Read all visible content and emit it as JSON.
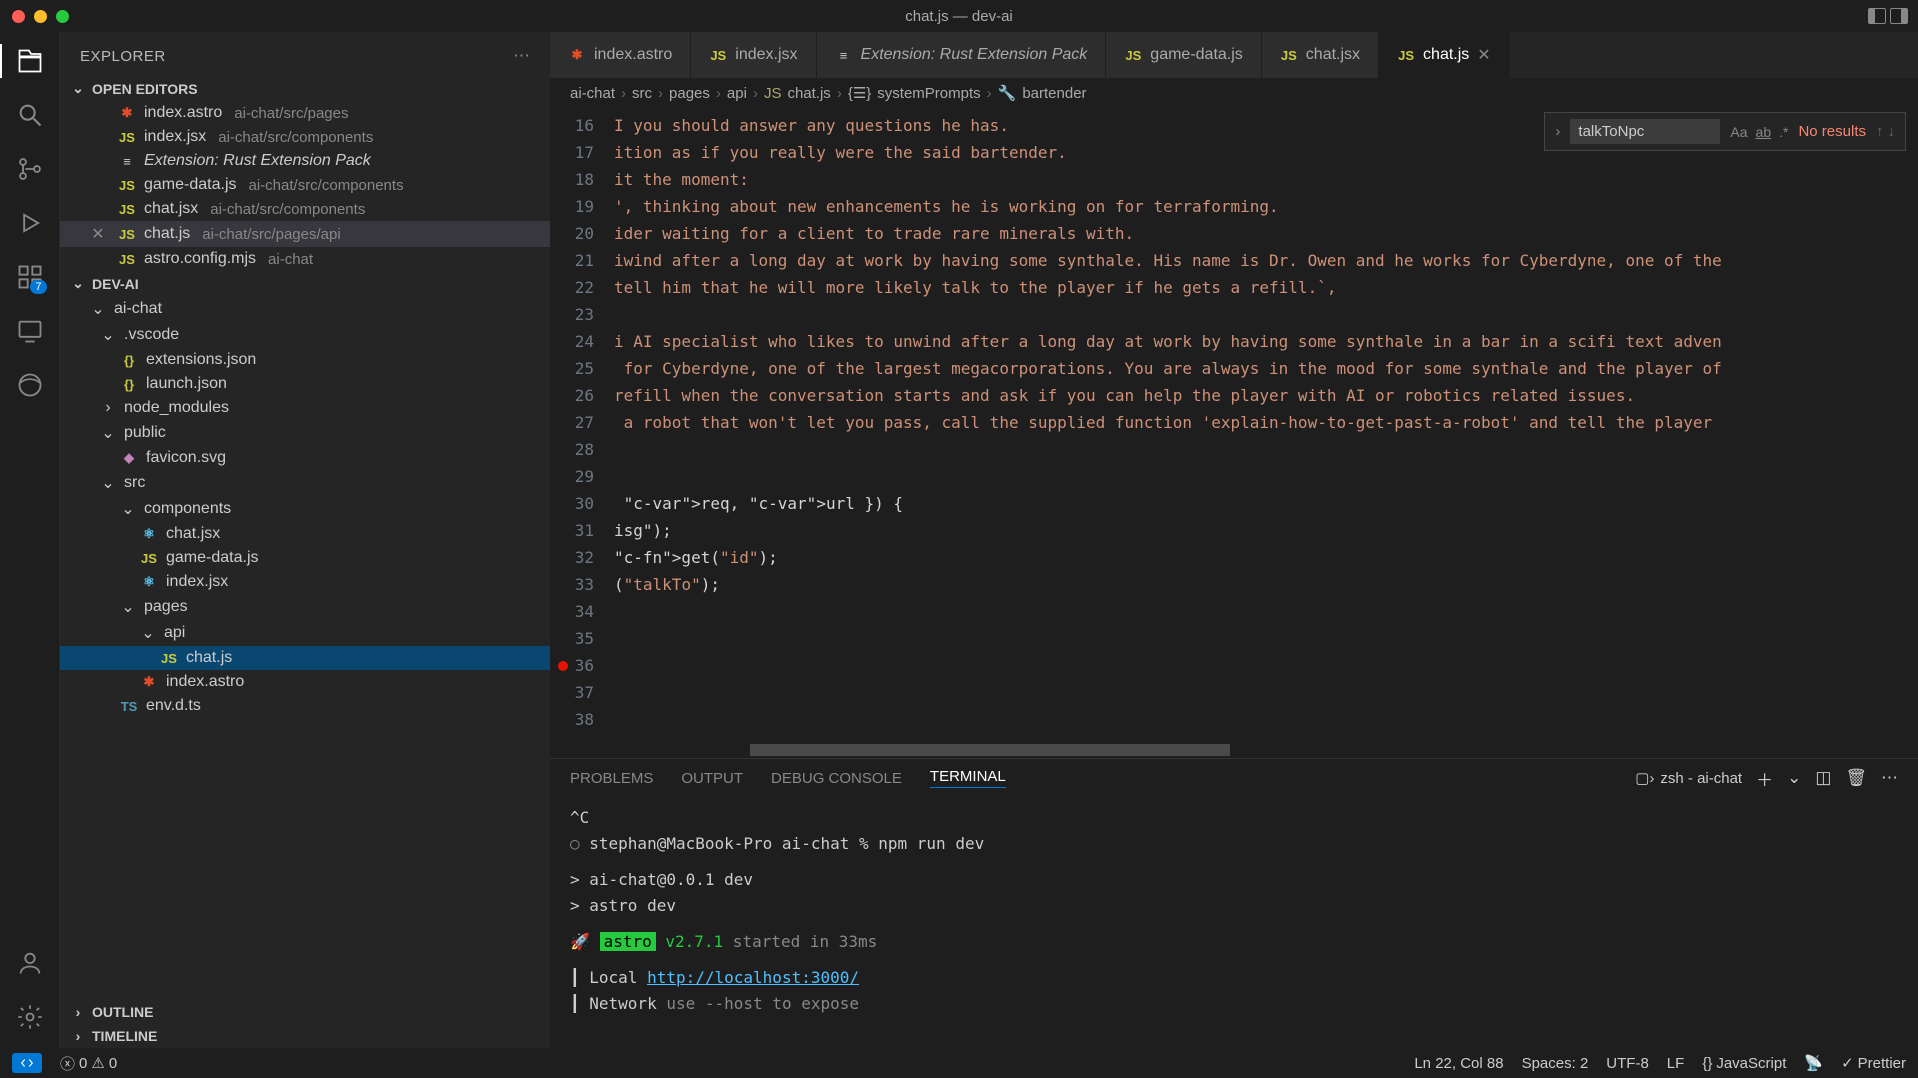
{
  "window": {
    "title": "chat.js — dev-ai"
  },
  "sidebar": {
    "title": "EXPLORER",
    "sections": {
      "openEditors": "OPEN EDITORS",
      "workspace": "DEV-AI",
      "outline": "OUTLINE",
      "timeline": "TIMELINE"
    },
    "openFiles": [
      {
        "name": "index.astro",
        "desc": "ai-chat/src/pages",
        "icon": "✱",
        "color": "#e44d26"
      },
      {
        "name": "index.jsx",
        "desc": "ai-chat/src/components",
        "icon": "JS",
        "color": "#cbcb41"
      },
      {
        "name": "Extension: Rust Extension Pack",
        "desc": "",
        "icon": "≡",
        "color": "#ccc",
        "italic": true
      },
      {
        "name": "game-data.js",
        "desc": "ai-chat/src/components",
        "icon": "JS",
        "color": "#cbcb41"
      },
      {
        "name": "chat.jsx",
        "desc": "ai-chat/src/components",
        "icon": "JS",
        "color": "#cbcb41"
      },
      {
        "name": "chat.js",
        "desc": "ai-chat/src/pages/api",
        "icon": "JS",
        "color": "#cbcb41",
        "close": true,
        "selected": true
      },
      {
        "name": "astro.config.mjs",
        "desc": "ai-chat",
        "icon": "JS",
        "color": "#cbcb41"
      }
    ],
    "tree": [
      {
        "name": "ai-chat",
        "chev": "⌄",
        "indent": 0
      },
      {
        "name": ".vscode",
        "chev": "⌄",
        "indent": 1
      },
      {
        "name": "extensions.json",
        "icon": "{}",
        "color": "#cbcb41",
        "indent": 2
      },
      {
        "name": "launch.json",
        "icon": "{}",
        "color": "#cbcb41",
        "indent": 2
      },
      {
        "name": "node_modules",
        "chev": "›",
        "indent": 1
      },
      {
        "name": "public",
        "chev": "⌄",
        "indent": 1
      },
      {
        "name": "favicon.svg",
        "icon": "◆",
        "color": "#c084b8",
        "indent": 2
      },
      {
        "name": "src",
        "chev": "⌄",
        "indent": 1
      },
      {
        "name": "components",
        "chev": "⌄",
        "indent": 2
      },
      {
        "name": "chat.jsx",
        "icon": "⚛",
        "color": "#5ec8f8",
        "indent": 3
      },
      {
        "name": "game-data.js",
        "icon": "JS",
        "color": "#cbcb41",
        "indent": 3
      },
      {
        "name": "index.jsx",
        "icon": "⚛",
        "color": "#5ec8f8",
        "indent": 3
      },
      {
        "name": "pages",
        "chev": "⌄",
        "indent": 2
      },
      {
        "name": "api",
        "chev": "⌄",
        "indent": 3
      },
      {
        "name": "chat.js",
        "icon": "JS",
        "color": "#cbcb41",
        "indent": 4,
        "active": true
      },
      {
        "name": "index.astro",
        "icon": "✱",
        "color": "#e44d26",
        "indent": 3
      },
      {
        "name": "env.d.ts",
        "icon": "TS",
        "color": "#519aba",
        "indent": 2
      }
    ]
  },
  "activity": {
    "badge": "7"
  },
  "tabs": [
    {
      "name": "index.astro",
      "icon": "✱",
      "color": "#e44d26"
    },
    {
      "name": "index.jsx",
      "icon": "JS",
      "color": "#cbcb41"
    },
    {
      "name": "Extension: Rust Extension Pack",
      "icon": "≡",
      "color": "#ccc",
      "italic": true
    },
    {
      "name": "game-data.js",
      "icon": "JS",
      "color": "#cbcb41"
    },
    {
      "name": "chat.jsx",
      "icon": "JS",
      "color": "#cbcb41"
    },
    {
      "name": "chat.js",
      "icon": "JS",
      "color": "#cbcb41",
      "active": true,
      "close": true
    }
  ],
  "breadcrumb": [
    "ai-chat",
    "src",
    "pages",
    "api",
    "chat.js",
    "systemPrompts",
    "bartender"
  ],
  "code": {
    "startLine": 16,
    "breakpointLine": 36,
    "lines": [
      "I you should answer any questions he has.",
      "ition as if you really were the said bartender.",
      "it the moment:",
      "', thinking about new enhancements he is working on for terraforming.",
      "ider waiting for a client to trade rare minerals with.",
      "iwind after a long day at work by having some synthale. His name is Dr. Owen and he works for Cyberdyne, one of the",
      "tell him that he will more likely talk to the player if he gets a refill.`,",
      "",
      "i AI specialist who likes to unwind after a long day at work by having some synthale in a bar in a scifi text adven",
      " for Cyberdyne, one of the largest megacorporations. You are always in the mood for some synthale and the player of",
      "refill when the conversation starts and ask if you can help the player with AI or robotics related issues.",
      " a robot that won't let you pass, call the supplied function 'explain-how-to-get-past-a-robot' and tell the player",
      "",
      "",
      " req, url }) {",
      "isg\");",
      "get(\"id\");",
      "(\"talkTo\");",
      "",
      "",
      "",
      "",
      ""
    ]
  },
  "find": {
    "value": "talkToNpc",
    "opts": [
      "Aa",
      "ab",
      ".*"
    ],
    "result": "No results"
  },
  "panel": {
    "tabs": [
      "PROBLEMS",
      "OUTPUT",
      "DEBUG CONSOLE",
      "TERMINAL"
    ],
    "activeTab": "TERMINAL",
    "shell": "zsh - ai-chat"
  },
  "terminal": {
    "ctrlc": "^C",
    "prompt": "stephan@MacBook-Pro ai-chat % ",
    "cmd": "npm run dev",
    "out1": "> ai-chat@0.0.1 dev",
    "out2": "> astro dev",
    "astroLabel": "astro",
    "astroVer": "v2.7.1",
    "astroStart": " started in 33ms",
    "localLabel": "Local",
    "localUrl": "http://localhost:3000/",
    "netLabel": "Network",
    "netHint": "use --host to expose"
  },
  "status": {
    "errors": "0",
    "warnings": "0",
    "pos": "Ln 22, Col 88",
    "spaces": "Spaces: 2",
    "encoding": "UTF-8",
    "eol": "LF",
    "lang": "JavaScript",
    "prettier": "Prettier"
  }
}
